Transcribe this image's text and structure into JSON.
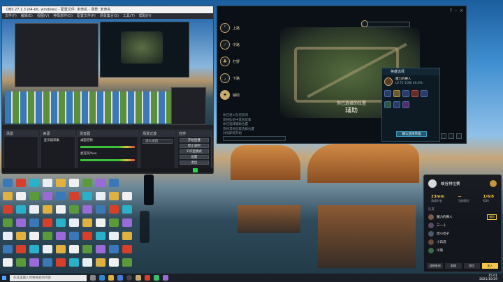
{
  "obs": {
    "title": "OBS 27.1.3 (64-bit, windows) - 配置文件: 未命名 - 场景: 未命名",
    "menu": [
      "文件(F)",
      "编辑(E)",
      "视图(V)",
      "停靠部件(D)",
      "配置文件(P)",
      "场景集合(S)",
      "工具(T)",
      "帮助(H)"
    ],
    "panels": {
      "scenes_header": "场景",
      "sources_header": "来源",
      "mixer_header": "混音器",
      "transitions_header": "场景过渡",
      "controls_header": "控件"
    },
    "source_item": "显示器采集",
    "mixer_items": [
      "桌面音频",
      "麦克风/Aux"
    ],
    "transition_label": "淡入淡出",
    "controls": [
      "开始直播",
      "停止录制",
      "工作室模式",
      "设置",
      "退出"
    ]
  },
  "lol": {
    "lanes": [
      {
        "label": "上路",
        "icon": "top-lane-icon"
      },
      {
        "label": "中路",
        "icon": "mid-lane-icon"
      },
      {
        "label": "打野",
        "icon": "jungle-icon"
      },
      {
        "label": "下路",
        "icon": "bot-lane-icon"
      },
      {
        "label": "辅助",
        "icon": "support-icon",
        "active": true
      }
    ],
    "selected_role_line1": "你已选择的位置",
    "selected_role": "辅助",
    "team_header": "英雄选择",
    "player_name": "魔力的赛人",
    "player_stats": "LV.75  10局  40.0%",
    "confirm_button": "确认选择英雄",
    "chat_messages": [
      "你已进入队伍房间",
      "等待队伍中其他玩家",
      "你已选择辅助位置",
      "等待其他玩家选择位置",
      "对局即将开始"
    ]
  },
  "overlay": {
    "title": "峡谷排位赛",
    "stats": [
      {
        "value": "23min",
        "label": "游戏时长"
      },
      {
        "value": "--",
        "label": "当前段位"
      },
      {
        "value": "1/6/8",
        "label": "KDA"
      }
    ],
    "section": "队友",
    "players": [
      {
        "name": "魔力的赛人",
        "tag": "辅助"
      },
      {
        "name": "三一十",
        "tag": ""
      },
      {
        "name": "周小亮子",
        "tag": ""
      },
      {
        "name": "小白说",
        "tag": ""
      },
      {
        "name": "冷萌",
        "tag": ""
      }
    ],
    "tabs": [
      "战绩查询",
      "英雄",
      "段位",
      "加入"
    ]
  },
  "taskbar": {
    "search_placeholder": "在这里输入你要搜索的内容",
    "time": "15:01",
    "date": "2021/10/29"
  }
}
